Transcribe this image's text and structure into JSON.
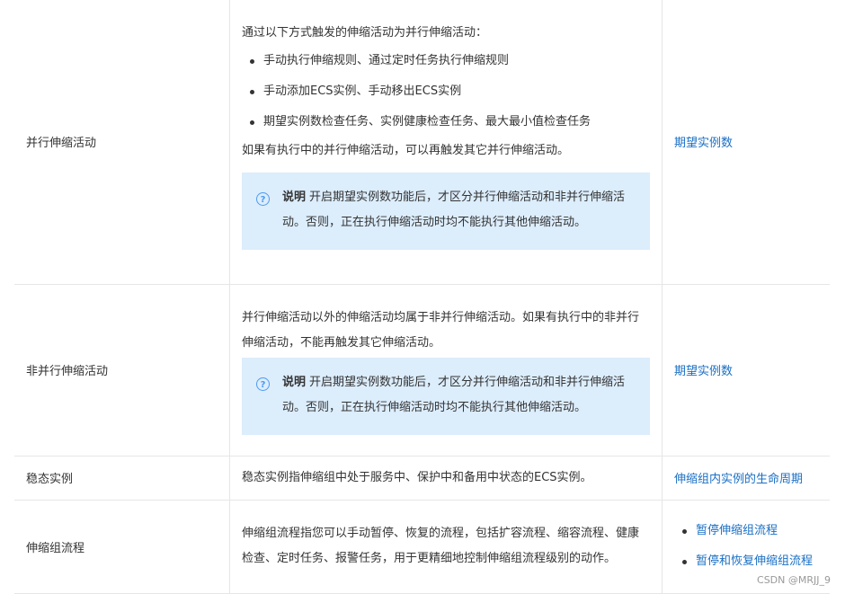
{
  "rows": [
    {
      "term": "并行伸缩活动",
      "intro": "通过以下方式触发的伸缩活动为并行伸缩活动：",
      "bullets": [
        "手动执行伸缩规则、通过定时任务执行伸缩规则",
        "手动添加ECS实例、手动移出ECS实例",
        "期望实例数检查任务、实例健康检查任务、最大最小值检查任务"
      ],
      "after": "如果有执行中的并行伸缩活动，可以再触发其它并行伸缩活动。",
      "note_label": "说明",
      "note_text": "开启期望实例数功能后，才区分并行伸缩活动和非并行伸缩活动。否则，正在执行伸缩活动时均不能执行其他伸缩活动。",
      "link": "期望实例数"
    },
    {
      "term": "非并行伸缩活动",
      "desc": "并行伸缩活动以外的伸缩活动均属于非并行伸缩活动。如果有执行中的非并行伸缩活动，不能再触发其它伸缩活动。",
      "note_label": "说明",
      "note_text": "开启期望实例数功能后，才区分并行伸缩活动和非并行伸缩活动。否则，正在执行伸缩活动时均不能执行其他伸缩活动。",
      "link": "期望实例数"
    },
    {
      "term": "稳态实例",
      "desc": "稳态实例指伸缩组中处于服务中、保护中和备用中状态的ECS实例。",
      "link": "伸缩组内实例的生命周期"
    },
    {
      "term": "伸缩组流程",
      "desc": "伸缩组流程指您可以手动暂停、恢复的流程，包括扩容流程、缩容流程、健康检查、定时任务、报警任务，用于更精细地控制伸缩组流程级别的动作。",
      "links": [
        "暂停伸缩组流程",
        "暂停和恢复伸缩组流程"
      ]
    }
  ],
  "watermark": "CSDN @MRJJ_9",
  "colors": {
    "link": "#1a6fc4",
    "note_bg": "#dcedfc",
    "note_icon": "#4c9bf2"
  },
  "icons": {
    "note": "question-circle-icon"
  }
}
